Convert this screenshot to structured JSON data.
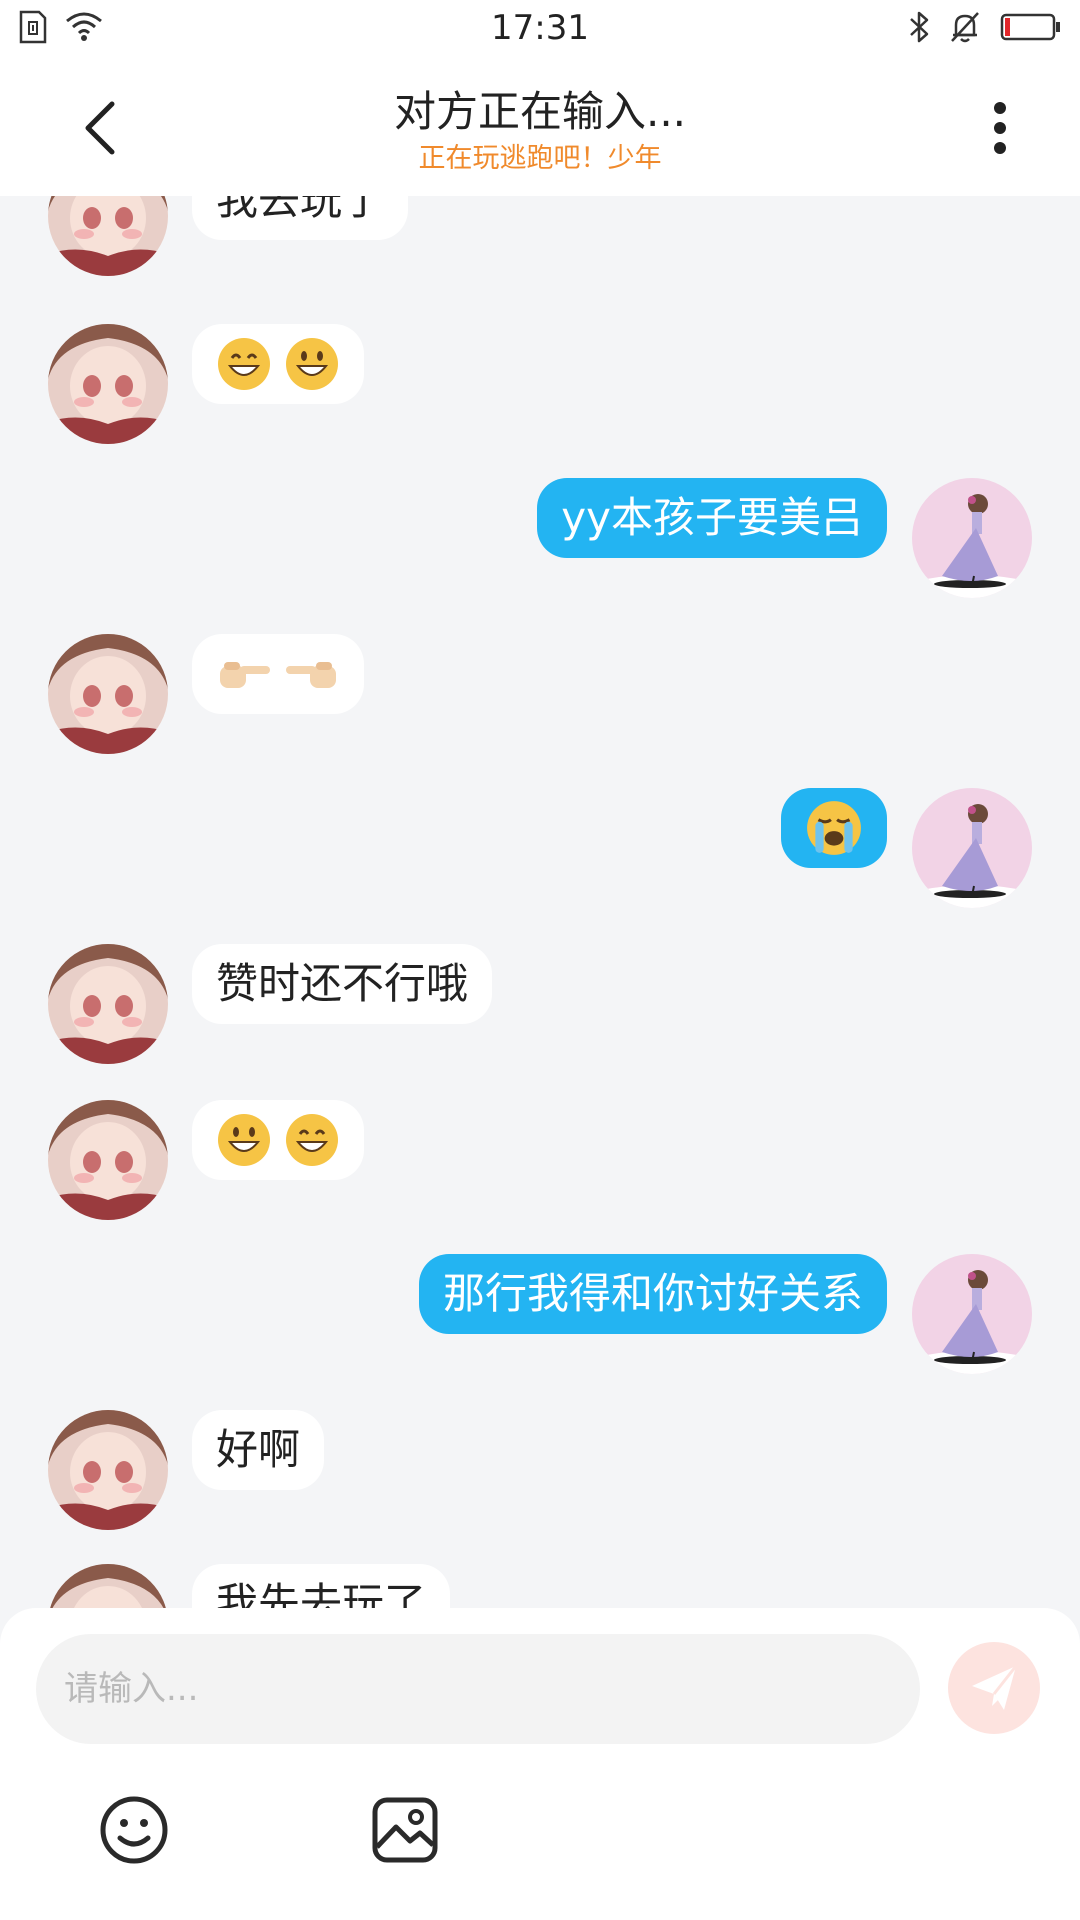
{
  "status_bar": {
    "time": "17:31",
    "battery_color": "#e2262a"
  },
  "header": {
    "title": "对方正在输入...",
    "subtitle": "正在玩逃跑吧！少年",
    "subtitle_color": "#f08a2c"
  },
  "colors": {
    "outgoing_bubble": "#23b4f2",
    "incoming_bubble": "#ffffff",
    "background": "#f4f5f7"
  },
  "messages": [
    {
      "side": "in",
      "type": "text",
      "text": "我去玩了"
    },
    {
      "side": "in",
      "type": "emoji",
      "emoji": [
        "grinning-smile-eyes",
        "grinning-big-eyes"
      ]
    },
    {
      "side": "out",
      "type": "text",
      "text": "yy本孩子要美吕"
    },
    {
      "side": "in",
      "type": "emoji",
      "emoji": [
        "point-right",
        "point-left"
      ]
    },
    {
      "side": "out",
      "type": "emoji",
      "emoji": [
        "loudly-crying"
      ]
    },
    {
      "side": "in",
      "type": "text",
      "text": "赞时还不行哦"
    },
    {
      "side": "in",
      "type": "emoji",
      "emoji": [
        "grinning-big-eyes",
        "grinning-smile-eyes"
      ]
    },
    {
      "side": "out",
      "type": "text",
      "text": "那行我得和你讨好关系"
    },
    {
      "side": "in",
      "type": "text",
      "text": "好啊"
    },
    {
      "side": "in",
      "type": "text",
      "text": "我先去玩了"
    }
  ],
  "input": {
    "placeholder": "请输入..."
  },
  "toolbar": {
    "icons": [
      "smiley-icon",
      "image-icon"
    ]
  }
}
